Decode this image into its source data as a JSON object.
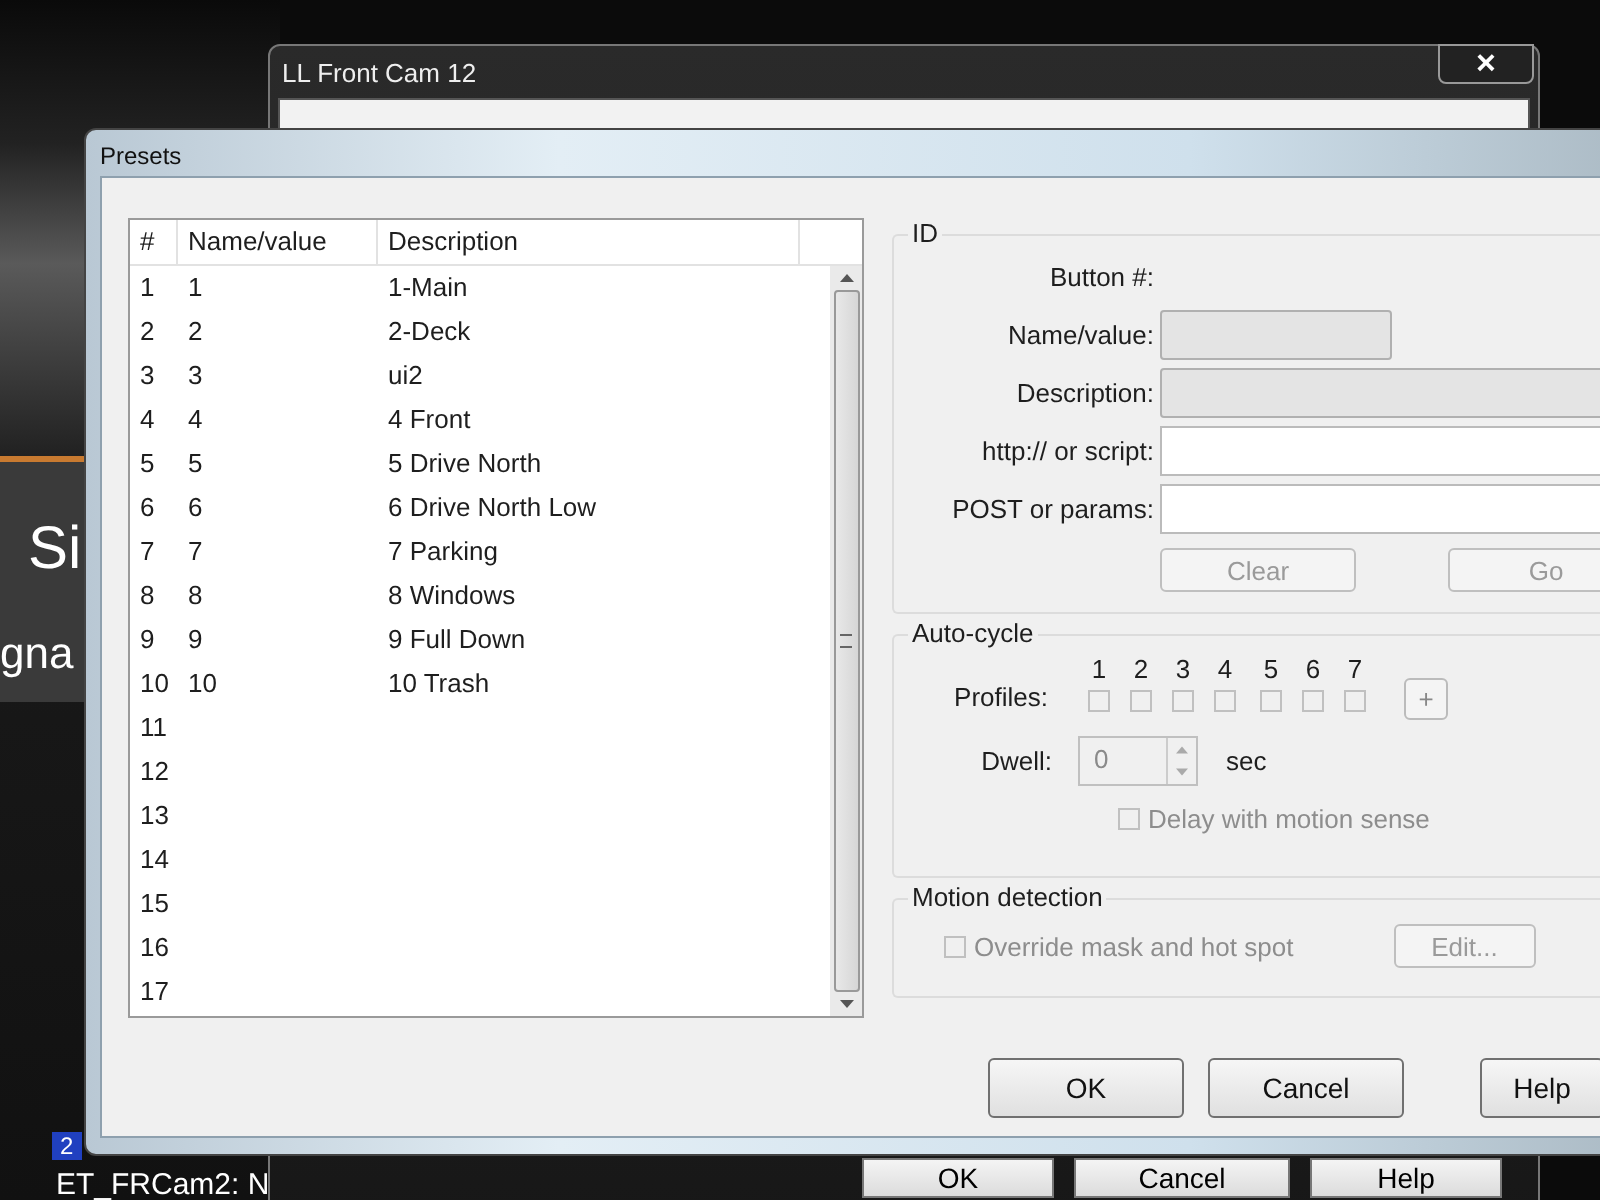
{
  "background": {
    "overlay_texts": [
      "Si",
      "gna"
    ],
    "camera_number": "2",
    "camera_label": "ET_FRCam2: N"
  },
  "back_window": {
    "title": "LL Front Cam 12",
    "close": "×",
    "buttons": [
      "OK",
      "Cancel",
      "Help"
    ]
  },
  "dialog": {
    "title": "Presets",
    "table": {
      "columns": [
        "#",
        "Name/value",
        "Description"
      ],
      "rows": [
        [
          "1",
          "1",
          "1-Main"
        ],
        [
          "2",
          "2",
          "2-Deck"
        ],
        [
          "3",
          "3",
          "ui2"
        ],
        [
          "4",
          "4",
          "4 Front"
        ],
        [
          "5",
          "5",
          "5 Drive North"
        ],
        [
          "6",
          "6",
          "6 Drive North Low"
        ],
        [
          "7",
          "7",
          "7 Parking"
        ],
        [
          "8",
          "8",
          "8 Windows"
        ],
        [
          "9",
          "9",
          "9 Full Down"
        ],
        [
          "10",
          "10",
          "10 Trash"
        ],
        [
          "11"
        ],
        [
          "12"
        ],
        [
          "13"
        ],
        [
          "14"
        ],
        [
          "15"
        ],
        [
          "16"
        ],
        [
          "17"
        ]
      ]
    },
    "id_group": {
      "title": "ID",
      "fields": [
        {
          "kind": "text",
          "label": "Button #:"
        },
        {
          "kind": "short",
          "label": "Name/value:",
          "disabled": true
        },
        {
          "kind": "wide",
          "label": "Description:",
          "disabled": true
        },
        {
          "kind": "wide",
          "label": "http:// or script:",
          "disabled": false
        },
        {
          "kind": "wide",
          "label": "POST or params:",
          "disabled": false
        }
      ],
      "buttons": [
        {
          "label": "Clear",
          "disabled": true
        },
        {
          "label": "Go",
          "disabled": true
        }
      ]
    },
    "auto_cycle": {
      "title": "Auto-cycle",
      "profiles_label": "Profiles:",
      "profiles": [
        {
          "label": "1",
          "checked": false
        },
        {
          "label": "2",
          "checked": false
        },
        {
          "label": "3",
          "checked": false
        },
        {
          "label": "4",
          "checked": false
        },
        {
          "label": "5",
          "checked": false
        },
        {
          "label": "6",
          "checked": false
        },
        {
          "label": "7",
          "checked": false
        }
      ],
      "add_button": "+",
      "dwell_label": "Dwell:",
      "dwell_value": "0",
      "dwell_unit": "sec",
      "delay": {
        "label": "Delay with motion sense",
        "checked": false,
        "disabled": true
      }
    },
    "motion_detection": {
      "title": "Motion detection",
      "override": {
        "label": "Override mask and hot spot",
        "checked": false,
        "disabled": true
      },
      "edit_button": {
        "label": "Edit...",
        "disabled": true
      }
    },
    "buttons": [
      "OK",
      "Cancel",
      "Help"
    ]
  }
}
